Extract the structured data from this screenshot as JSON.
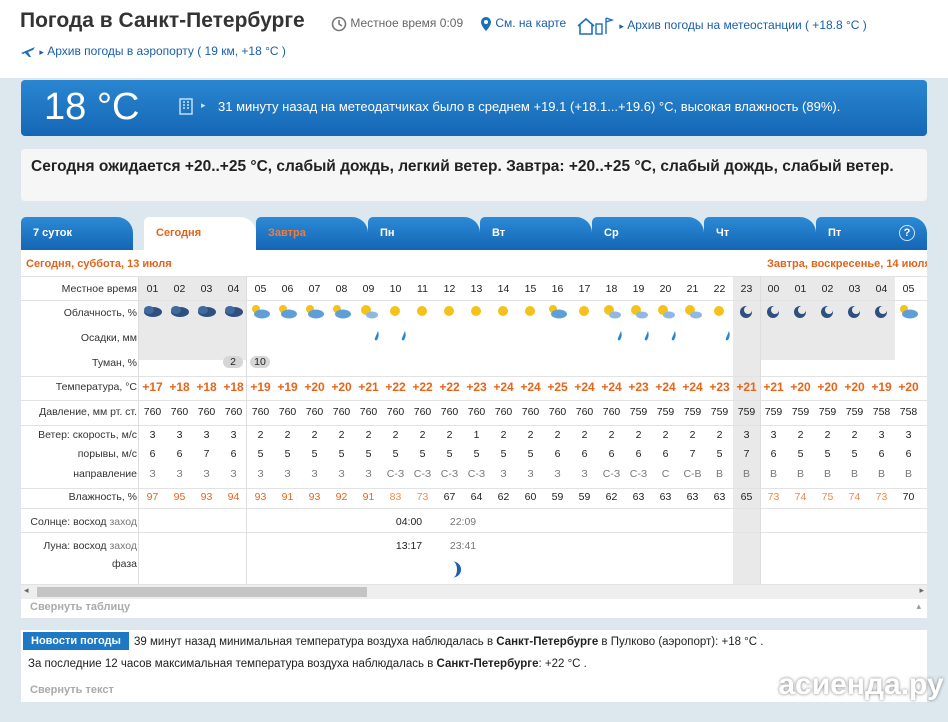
{
  "header": {
    "title": "Погода в Санкт-Петербурге",
    "local_time_label": "Местное время",
    "local_time": "0:09",
    "map_link": "См. на карте",
    "station_archive": "Архив погоды на метеостанции ( +18.8 °C )",
    "airport_archive": "Архив погоды в аэропорту ( 19 км, +18 °C )"
  },
  "now": {
    "temperature": "18 °C",
    "description": "31 минуту назад на метеодатчиках было в среднем +19.1 (+18.1...+19.6) °C, высокая влажность (89%)."
  },
  "forecast_text": "Сегодня ожидается +20..+25 °C, слабый дождь, легкий ветер. Завтра: +20..+25 °C, слабый дождь, слабый ветер.",
  "tabs": [
    {
      "label": "7 суток"
    },
    {
      "label": "Сегодня"
    },
    {
      "label": "Завтра"
    },
    {
      "label": "Пн"
    },
    {
      "label": "Вт"
    },
    {
      "label": "Ср"
    },
    {
      "label": "Чт"
    },
    {
      "label": "Пт"
    }
  ],
  "help_label": "?",
  "table": {
    "today_header": "Сегодня, суббота, 13 июля",
    "tomorrow_header": "Завтра, воскресенье, 14 июля",
    "row_labels": {
      "time": "Местное время",
      "cloud": "Облачность, %",
      "precip": "Осадки, мм",
      "fog": "Туман, %",
      "temp": "Температура, °C",
      "pressure": "Давление, мм рт. ст.",
      "wind": "Ветер: скорость, м/с",
      "gust": "порывы, м/с",
      "dir": "направление",
      "humid": "Влажность, %",
      "sun": "Солнце:",
      "sun_rise": "восход",
      "sun_set": "заход",
      "moon": "Луна:",
      "moon_rise": "восход",
      "moon_set": "заход",
      "moon_phase": "фаза"
    },
    "hours": [
      "01",
      "02",
      "03",
      "04",
      "05",
      "06",
      "07",
      "08",
      "09",
      "10",
      "11",
      "12",
      "13",
      "14",
      "15",
      "16",
      "17",
      "18",
      "19",
      "20",
      "21",
      "22",
      "23",
      "00",
      "01",
      "02",
      "03",
      "04",
      "05"
    ],
    "weather_icons": [
      "cloud-rain-night-icon",
      "cloud-rain-night-icon",
      "cloud-rain-night-icon",
      "cloud-rain-night-icon",
      "cloud-sun-icon",
      "cloud-sun-icon",
      "cloud-sun-icon",
      "cloud-sun-icon",
      "sun-cloud-icon",
      "sun-icon",
      "sun-icon",
      "sun-icon",
      "sun-icon",
      "sun-icon",
      "sun-icon",
      "cloud-sun-icon",
      "sun-icon",
      "sun-cloud-icon",
      "sun-cloud-icon",
      "sun-cloud-icon",
      "sun-cloud-icon",
      "sun-icon",
      "moon-icon",
      "moon-icon",
      "moon-icon",
      "moon-icon",
      "moon-icon",
      "moon-icon",
      "cloud-sun-icon"
    ],
    "precip_drops": [
      "",
      "",
      "",
      "",
      "",
      "",
      "",
      "",
      "drop-icon",
      "drop-icon",
      "",
      "",
      "",
      "",
      "",
      "",
      "",
      "drop-icon",
      "drop-icon",
      "drop-icon",
      "",
      "drop-icon",
      "",
      "",
      "",
      "",
      "",
      "",
      ""
    ],
    "fog": [
      "",
      "",
      "",
      "2",
      "10",
      "",
      "",
      "",
      "",
      "",
      "",
      "",
      "",
      "",
      "",
      "",
      "",
      "",
      "",
      "",
      "",
      "",
      "",
      "",
      "",
      "",
      "",
      "",
      ""
    ],
    "temperature": [
      "+17",
      "+18",
      "+18",
      "+18",
      "+19",
      "+19",
      "+20",
      "+20",
      "+21",
      "+22",
      "+22",
      "+22",
      "+23",
      "+24",
      "+24",
      "+25",
      "+24",
      "+24",
      "+23",
      "+24",
      "+24",
      "+23",
      "+21",
      "+21",
      "+20",
      "+20",
      "+20",
      "+19",
      "+20"
    ],
    "pressure": [
      "760",
      "760",
      "760",
      "760",
      "760",
      "760",
      "760",
      "760",
      "760",
      "760",
      "760",
      "760",
      "760",
      "760",
      "760",
      "760",
      "760",
      "760",
      "759",
      "759",
      "759",
      "759",
      "759",
      "759",
      "759",
      "759",
      "759",
      "758",
      "758"
    ],
    "wind": [
      "3",
      "3",
      "3",
      "3",
      "2",
      "2",
      "2",
      "2",
      "2",
      "2",
      "2",
      "2",
      "1",
      "2",
      "2",
      "2",
      "2",
      "2",
      "2",
      "2",
      "2",
      "2",
      "3",
      "3",
      "2",
      "2",
      "2",
      "3",
      "3"
    ],
    "gust": [
      "6",
      "6",
      "7",
      "6",
      "5",
      "5",
      "5",
      "5",
      "5",
      "5",
      "5",
      "5",
      "5",
      "5",
      "5",
      "6",
      "6",
      "6",
      "6",
      "6",
      "7",
      "5",
      "7",
      "6",
      "5",
      "5",
      "5",
      "6",
      "6"
    ],
    "direction": [
      "З",
      "З",
      "З",
      "З",
      "З",
      "З",
      "З",
      "З",
      "З",
      "С-З",
      "С-З",
      "С-З",
      "С-З",
      "З",
      "З",
      "З",
      "З",
      "С-З",
      "С-З",
      "С",
      "С-В",
      "В",
      "В",
      "В",
      "В",
      "В",
      "В",
      "В",
      "В"
    ],
    "humidity": [
      "97",
      "95",
      "93",
      "94",
      "93",
      "91",
      "93",
      "92",
      "91",
      "83",
      "73",
      "67",
      "64",
      "62",
      "60",
      "59",
      "59",
      "62",
      "63",
      "63",
      "63",
      "63",
      "65",
      "73",
      "74",
      "75",
      "74",
      "73",
      "70"
    ],
    "sun_rise_time": "04:00",
    "sun_set_time": "22:09",
    "moon_rise_time": "13:17",
    "moon_set_time": "23:41",
    "collapse_label": "Свернуть таблицу"
  },
  "news": {
    "badge": "Новости погоды",
    "line1_pre": "39 минут назад минимальная температура воздуха наблюдалась в ",
    "line1_city": "Санкт-Петербурге",
    "line1_post": " в Пулково (аэропорт): +18 °C .",
    "line2_pre": "За последние 12 часов максимальная температура воздуха наблюдалась в ",
    "line2_city": "Санкт-Петербурге",
    "line2_post": ": +22 °C .",
    "collapse_label": "Свернуть текст"
  },
  "watermark": "асиенда.ру",
  "colors": {
    "accent_blue": "#1a6fbd",
    "temp_orange": "#e8641a",
    "tab_blue": "#1f7acb"
  }
}
